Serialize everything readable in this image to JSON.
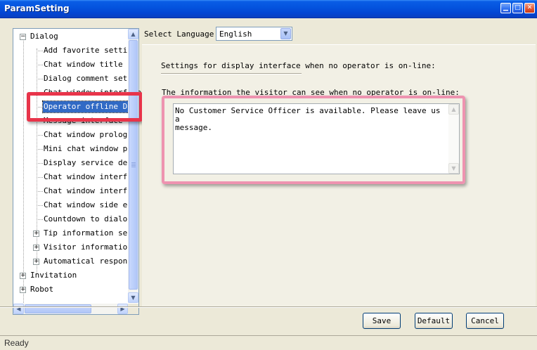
{
  "window": {
    "title": "ParamSetting",
    "controls": [
      "minimize",
      "maximize",
      "close"
    ]
  },
  "tree": {
    "items": [
      {
        "label": "Dialog",
        "level": 0,
        "expander": "−"
      },
      {
        "label": "Add favorite setting",
        "level": 1
      },
      {
        "label": "Chat window title se",
        "level": 1
      },
      {
        "label": "Dialog comment setti",
        "level": 1
      },
      {
        "label": "Chat window interface",
        "level": 1
      },
      {
        "label": "Operator offline Dis",
        "level": 1,
        "selected": true
      },
      {
        "label": "Message interface di",
        "level": 1
      },
      {
        "label": "Chat window prologue",
        "level": 1
      },
      {
        "label": "Mini chat window pro",
        "level": 1
      },
      {
        "label": "Display service depa",
        "level": 1
      },
      {
        "label": "Chat window interfac",
        "level": 1
      },
      {
        "label": "Chat window interfac",
        "level": 1
      },
      {
        "label": "Chat window side edg",
        "level": 1
      },
      {
        "label": "Countdown to dialog",
        "level": 1
      },
      {
        "label": "Tip information sett",
        "level": 1,
        "expander": "+"
      },
      {
        "label": "Visitor information",
        "level": 1,
        "expander": "+"
      },
      {
        "label": "Automatical response",
        "level": 1,
        "expander": "+"
      },
      {
        "label": "Invitation",
        "level": 0,
        "expander": "+"
      },
      {
        "label": "Robot",
        "level": 0,
        "expander": "+"
      }
    ]
  },
  "language": {
    "label": "Select Language",
    "selected": "English"
  },
  "content": {
    "section_title": "Settings for display interface when no operator is on-line:",
    "info_label": "The information the visitor can see when no operator is on-line:",
    "message": "No Customer Service Officer is available. Please leave us a\nmessage."
  },
  "buttons": {
    "save": "Save",
    "default": "Default",
    "cancel": "Cancel"
  },
  "status": {
    "text": "Ready"
  },
  "colors": {
    "title_bar": "#0452dd",
    "selection": "#316ac5",
    "red_highlight": "#e8344a",
    "pink_highlight": "#ee93b0"
  }
}
